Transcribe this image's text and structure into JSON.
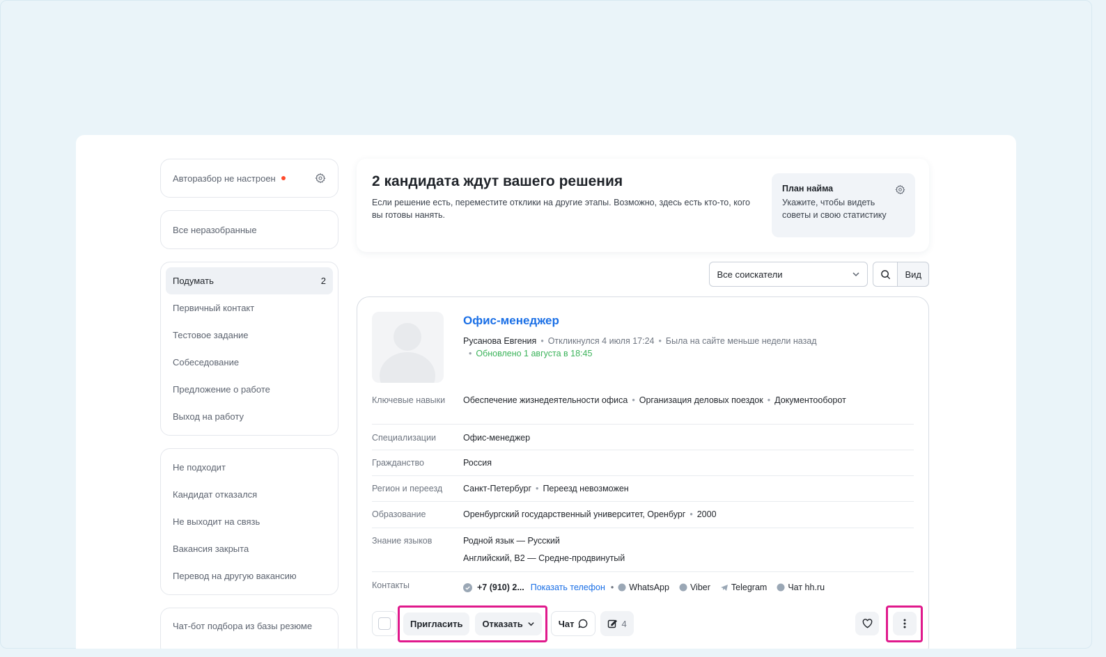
{
  "sidebar": {
    "auto_sort": {
      "label": "Авторазбор не настроен",
      "status_color": "#ff4a2b"
    },
    "all_unsorted": "Все неразобранные",
    "stages": [
      {
        "label": "Подумать",
        "count": "2",
        "active": true
      },
      {
        "label": "Первичный контакт"
      },
      {
        "label": "Тестовое задание"
      },
      {
        "label": "Собеседование"
      },
      {
        "label": "Предложение о работе"
      },
      {
        "label": "Выход на работу"
      }
    ],
    "rejections": [
      {
        "label": "Не подходит"
      },
      {
        "label": "Кандидат отказался"
      },
      {
        "label": "Не выходит на связь"
      },
      {
        "label": "Вакансия закрыта"
      },
      {
        "label": "Перевод на другую вакансию"
      }
    ],
    "chatbot": "Чат-бот подбора из базы резюме"
  },
  "info": {
    "title": "2 кандидата ждут вашего решения",
    "description": "Если решение есть, переместите отклики на другие этапы. Возможно, здесь есть кто-то, кого вы готовы нанять.",
    "plan_title": "План найма",
    "plan_text": "Укажите, чтобы видеть советы и свою статистику"
  },
  "toolbar": {
    "filter_value": "Все соискатели",
    "view_label": "Вид"
  },
  "candidate": {
    "job_title": "Офис-менеджер",
    "name": "Русанова Евгения",
    "responded": "Откликнулся 4 июля 17:24",
    "last_seen": "Была на сайте меньше недели назад",
    "updated": "Обновлено 1 августа в 18:45",
    "rows": {
      "skills_label": "Ключевые навыки",
      "skills": [
        "Обеспечение жизнедеятельности офиса",
        "Организация деловых поездок",
        "Документооборот"
      ],
      "spec_label": "Специализации",
      "spec": "Офис-менеджер",
      "citizenship_label": "Гражданство",
      "citizenship": "Россия",
      "region_label": "Регион и переезд",
      "region": "Санкт-Петербург",
      "relocation": "Переезд невозможен",
      "education_label": "Образование",
      "education": "Оренбургский государственный университет, Оренбург",
      "education_year": "2000",
      "languages_label": "Знание языков",
      "languages": [
        "Родной язык — Русский",
        "Английский, B2 — Средне-продвинутый"
      ],
      "contacts_label": "Контакты",
      "phone": "+7 (910) 2...",
      "show_phone": "Показать телефон",
      "messengers": [
        "WhatsApp",
        "Viber",
        "Telegram",
        "Чат hh.ru"
      ]
    },
    "actions": {
      "invite": "Пригласить",
      "reject": "Отказать",
      "chat": "Чат",
      "notes_count": "4"
    }
  },
  "colors": {
    "accent": "#1a6fe6",
    "highlight": "#e0198c",
    "updated_green": "#3bb35a"
  }
}
